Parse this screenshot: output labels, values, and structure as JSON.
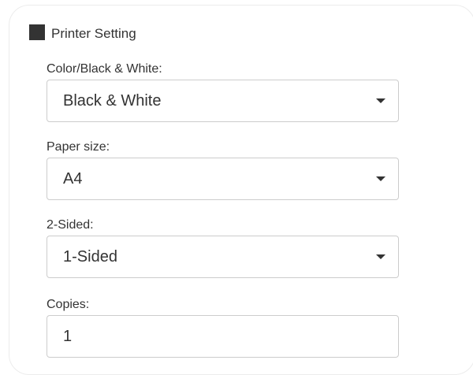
{
  "printer_setting": {
    "title": "Printer Setting",
    "icon": "square-icon",
    "fields": {
      "color": {
        "label": "Color/Black & White:",
        "value": "Black & White"
      },
      "paper_size": {
        "label": "Paper size:",
        "value": "A4"
      },
      "sided": {
        "label": "2-Sided:",
        "value": "1-Sided"
      },
      "copies": {
        "label": "Copies:",
        "value": "1"
      }
    }
  }
}
